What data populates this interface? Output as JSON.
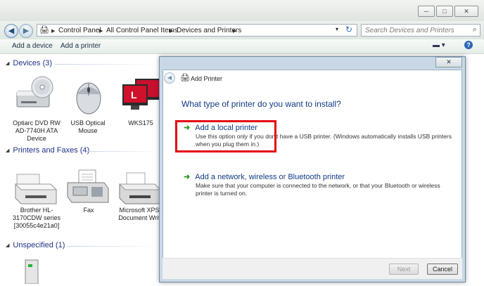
{
  "window": {
    "address": {
      "crumbs": [
        "Control Panel",
        "All Control Panel Items",
        "Devices and Printers"
      ],
      "search_placeholder": "Search Devices and Printers"
    },
    "toolbar": {
      "add_device": "Add a device",
      "add_printer": "Add a printer"
    }
  },
  "groups": {
    "devices": {
      "header": "Devices (3)",
      "items": [
        {
          "label": "Optiarc DVD RW AD-7740H ATA Device",
          "icon": "dvd-drive-icon"
        },
        {
          "label": "USB Optical Mouse",
          "icon": "mouse-icon"
        },
        {
          "label": "WKS175",
          "icon": "computer-icon"
        }
      ]
    },
    "printers": {
      "header": "Printers and Faxes (4)",
      "items": [
        {
          "label": "Brother HL-3170CDW series [30055c4e21a0]",
          "icon": "printer-icon"
        },
        {
          "label": "Fax",
          "icon": "fax-icon"
        },
        {
          "label": "Microsoft XPS Document Writ",
          "icon": "printer-icon"
        }
      ]
    },
    "unspecified": {
      "header": "Unspecified (1)"
    }
  },
  "dialog": {
    "title": "Add Printer",
    "question": "What type of printer do you want to install?",
    "options": [
      {
        "title": "Add a local printer",
        "desc1": "Use this option only if you don't have a USB printer. (Windows automatically installs USB printers",
        "desc2": "when you plug them in.)"
      },
      {
        "title": "Add a network, wireless or Bluetooth printer",
        "desc1": "Make sure that your computer is connected to the network, or that your Bluetooth or wireless",
        "desc2": "printer is turned on."
      }
    ],
    "buttons": {
      "next": "Next",
      "cancel": "Cancel"
    }
  },
  "colors": {
    "highlight": "#e30613",
    "link": "#103a85",
    "group_header": "#1e3287"
  }
}
